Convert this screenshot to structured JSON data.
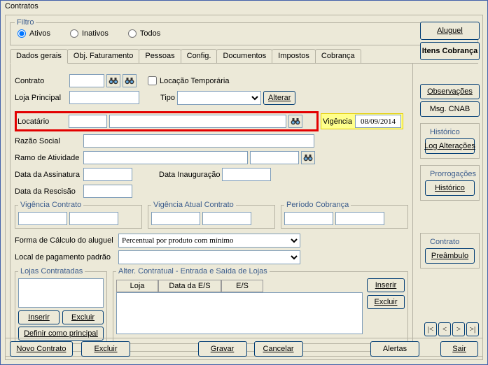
{
  "window": {
    "title": "Contratos"
  },
  "filter": {
    "legend": "Filtro",
    "options": {
      "active": "Ativos",
      "inactive": "Inativos",
      "all": "Todos"
    },
    "selected": "active"
  },
  "sidebar": {
    "aluguel": "Aluguel",
    "itens_cobranca": "Itens Cobrança",
    "observacoes": "Observações",
    "msg_cnab": "Msg. CNAB",
    "historico_legend": "Histórico",
    "log_alteracoes": "Log Alterações",
    "prorrogacoes_legend": "Prorrogações",
    "historico": "Histórico",
    "contrato_legend": "Contrato",
    "preambulo": "Preâmbulo"
  },
  "tabs": {
    "dados_gerais": "Dados gerais",
    "obj_faturamento": "Obj. Faturamento",
    "pessoas": "Pessoas",
    "config": "Config.",
    "documentos": "Documentos",
    "impostos": "Impostos",
    "cobranca": "Cobrança"
  },
  "general": {
    "contrato_lbl": "Contrato",
    "loja_principal_lbl": "Loja Principal",
    "loc_temp_lbl": "Locação Temporária",
    "tipo_lbl": "Tipo",
    "alterar_btn": "Alterar",
    "locatario_lbl": "Locatário",
    "vigencia_lbl": "Vigência",
    "vigencia_val": "08/09/2014",
    "razao_social_lbl": "Razão Social",
    "ramo_atividade_lbl": "Ramo de Atividade",
    "data_assinatura_lbl": "Data da Assinatura",
    "data_inauguracao_lbl": "Data Inauguração",
    "data_rescisao_lbl": "Data da Rescisão",
    "vig_contrato_legend": "Vigência Contrato",
    "vig_atual_legend": "Vigência Atual Contrato",
    "periodo_cobranca_legend": "Período Cobrança",
    "forma_calculo_lbl": "Forma de Cálculo do aluguel",
    "forma_calculo_val": "Percentual por produto com mínimo",
    "local_pag_lbl": "Local de pagamento padrão",
    "lojas_contratadas_legend": "Lojas Contratadas",
    "inserir_btn": "Inserir",
    "excluir_btn": "Excluir",
    "definir_principal_btn": "Definir como principal",
    "alter_contratual_legend": "Alter. Contratual - Entrada e Saída de Lojas",
    "col_loja": "Loja",
    "col_data_es": "Data da E/S",
    "col_es": "E/S"
  },
  "nav": {
    "first": "|<",
    "prev": "<",
    "next": ">",
    "last": ">|"
  },
  "footer": {
    "novo_contrato": "Novo Contrato",
    "excluir": "Excluir",
    "gravar": "Gravar",
    "cancelar": "Cancelar",
    "alertas": "Alertas",
    "sair": "Sair"
  }
}
